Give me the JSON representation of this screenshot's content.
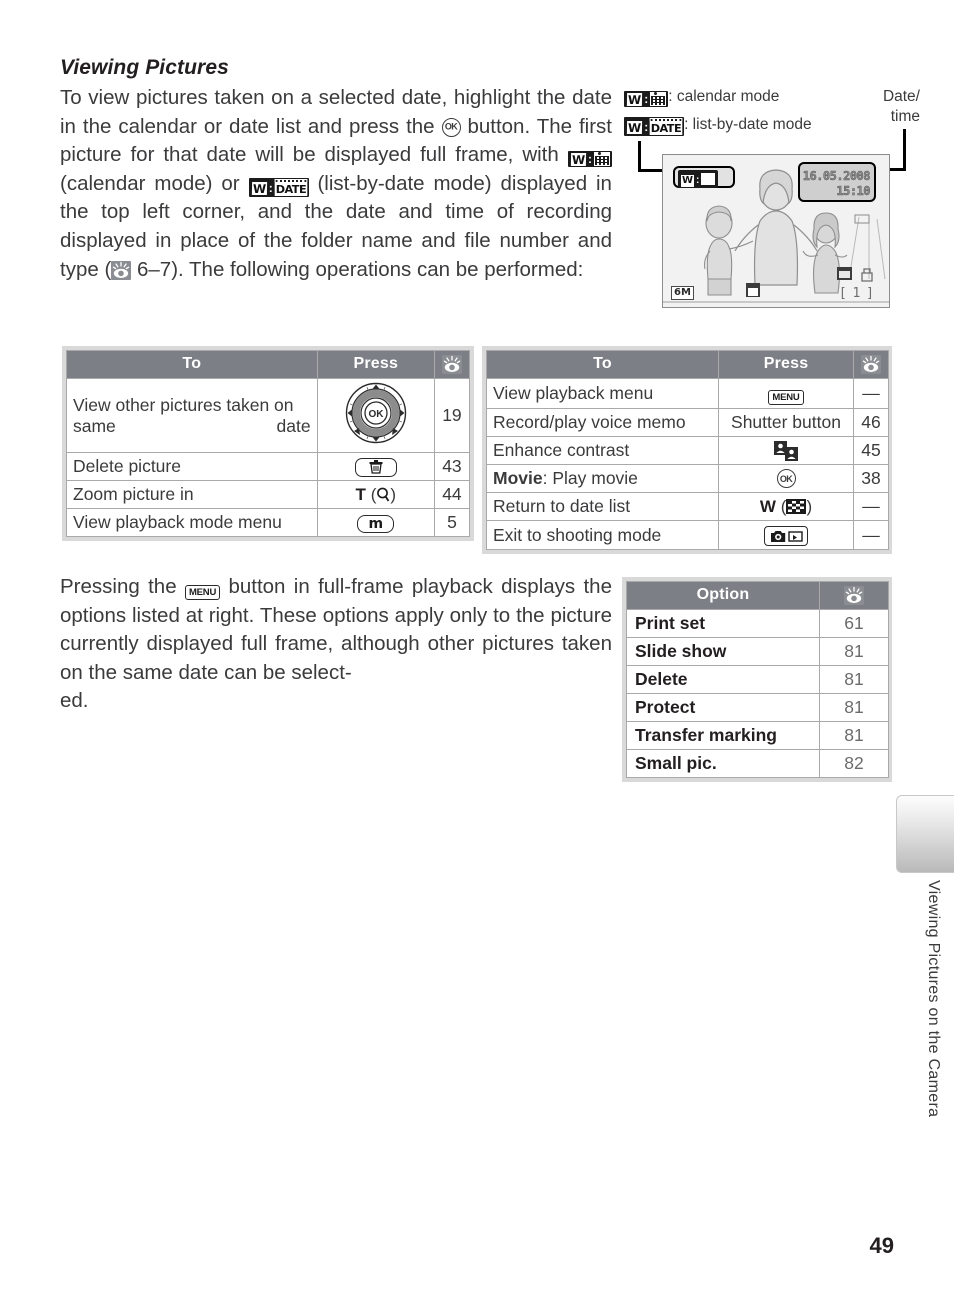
{
  "page": {
    "number": "49",
    "edge_tab_label": "Viewing Pictures on the Camera"
  },
  "section": {
    "title": "Viewing Pictures",
    "intro_paragraph": {
      "part1": "To view pictures taken on a selected date, highlight the date in the calendar or date list and press the",
      "part2": "button. The first picture for that date will be displayed full frame, with",
      "part3": "(calendar mode) or",
      "part4": "(list-by-date mode) displayed in the top left corner, and the date and time of recording displayed in place of the folder name and file number and type (",
      "part5": "6–7).  The following operations can be performed:"
    },
    "options_paragraph": {
      "part1": "Pressing the",
      "part2": "button in full-frame playback displays the options listed at right.  These options apply only to the picture currently displayed full frame, although other pictures taken on the same date can be select-",
      "part3": "ed."
    }
  },
  "illustration": {
    "legend_calendar": ": calendar mode",
    "legend_listdate": ": list-by-date mode",
    "legend_datetime_line1": "Date/",
    "legend_datetime_line2": "time",
    "lcd": {
      "date": "16.05.2008",
      "time": "15:10",
      "image_size": "6M",
      "frame_counter": "[    1 ]"
    }
  },
  "tables": {
    "playback_ops": {
      "headers": {
        "to": "To",
        "press": "Press",
        "ref": "reference-icon"
      },
      "rows": [
        {
          "to": "View  other  pictures  taken on same date",
          "press_icon": "multi-selector-dial",
          "press_label": "",
          "ref": "19"
        },
        {
          "to": "Delete picture",
          "press_icon": "trash-button",
          "press_label": "",
          "ref": "43"
        },
        {
          "to": "Zoom picture in",
          "press_icon": "tele-zoom",
          "press_label": "T (Q)",
          "ref": "44"
        },
        {
          "to": "View playback mode menu",
          "press_icon": "mode-button",
          "press_label": "m",
          "ref": "5"
        }
      ]
    },
    "display_ops": {
      "headers": {
        "to": "To",
        "press": "Press",
        "ref": "reference-icon"
      },
      "rows": [
        {
          "to": "View playback menu",
          "press_icon": "menu-button",
          "press_label": "MENU",
          "ref": "—"
        },
        {
          "to": "Record/play voice memo",
          "press_icon": "",
          "press_label": "Shutter button",
          "ref": "46"
        },
        {
          "to": "Enhance contrast",
          "press_icon": "d-lighting-icon",
          "press_label": "",
          "ref": "45"
        },
        {
          "to_bold": "Movie",
          "to": ": Play movie",
          "press_icon": "ok-button",
          "press_label": "",
          "ref": "38"
        },
        {
          "to": "Return to date list",
          "press_icon": "thumbnail-grid",
          "press_label": "W",
          "ref": "—"
        },
        {
          "to": "Exit to shooting mode",
          "press_icon": "camera-playback-toggle",
          "press_label": "",
          "ref": "—"
        }
      ]
    },
    "menu_options": {
      "headers": {
        "option": "Option",
        "ref": "reference-icon"
      },
      "rows": [
        {
          "option": "Print set",
          "ref": "61"
        },
        {
          "option": "Slide show",
          "ref": "81"
        },
        {
          "option": "Delete",
          "ref": "81"
        },
        {
          "option": "Protect",
          "ref": "81"
        },
        {
          "option": "Transfer marking",
          "ref": "81"
        },
        {
          "option": "Small pic.",
          "ref": "82"
        }
      ]
    }
  },
  "colors": {
    "table_header_gray": "#7c7f85",
    "table_border_gray": "#a9a9a9",
    "table_frame_gray": "#d9d9d9",
    "text": "#3b3b3d"
  }
}
